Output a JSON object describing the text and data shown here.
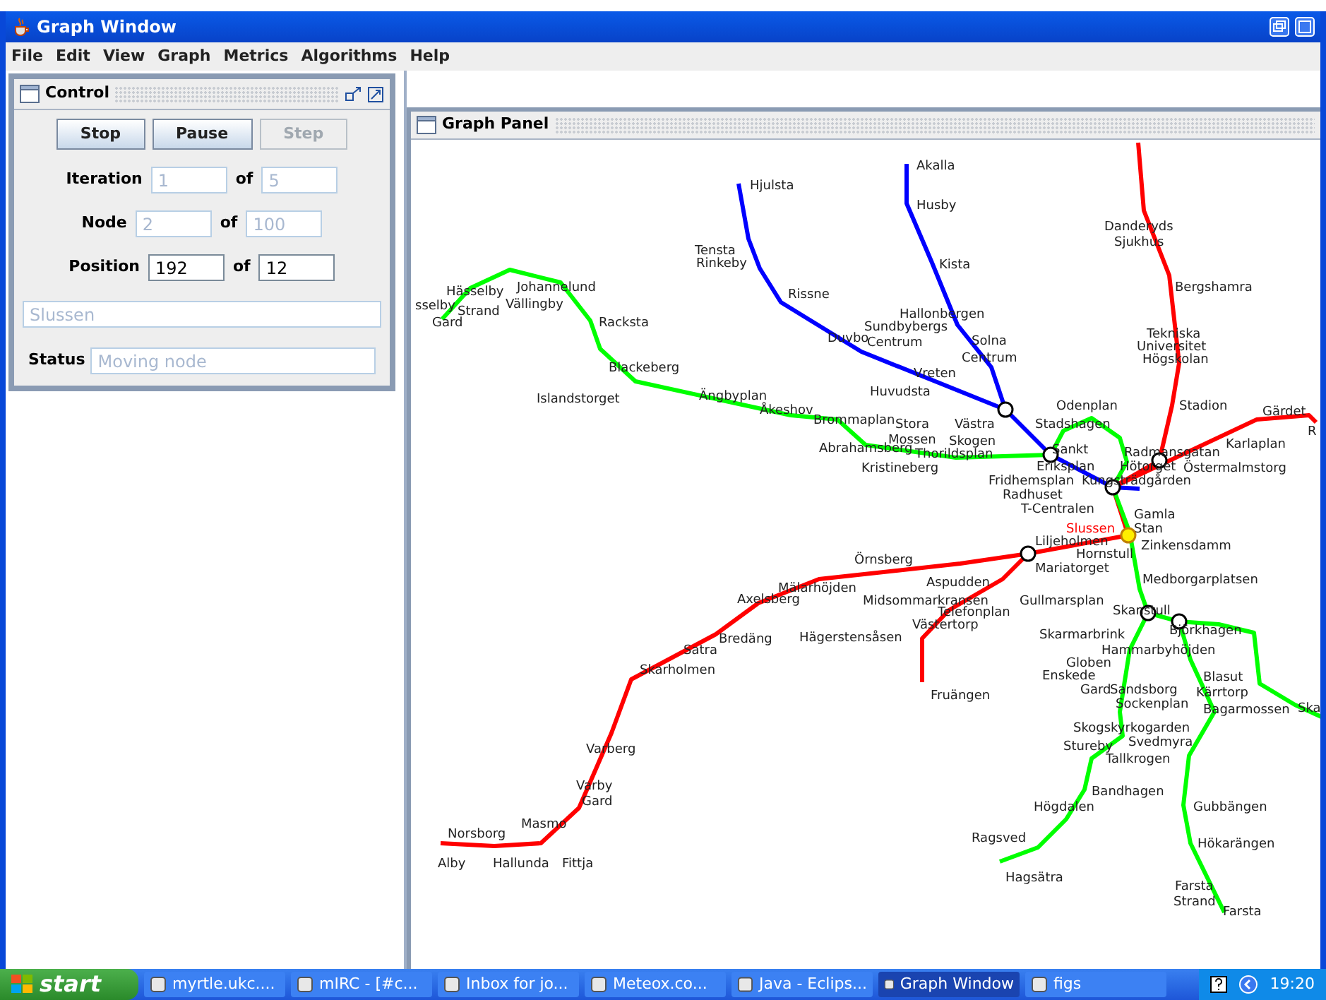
{
  "window": {
    "title": "Graph Window"
  },
  "menu": [
    "File",
    "Edit",
    "View",
    "Graph",
    "Metrics",
    "Algorithms",
    "Help"
  ],
  "control_panel": {
    "title": "Control",
    "buttons": [
      {
        "label": "Stop",
        "disabled": false
      },
      {
        "label": "Pause",
        "disabled": false
      },
      {
        "label": "Step",
        "disabled": true
      }
    ],
    "rows": [
      {
        "label": "Iteration",
        "value": "1",
        "of": "of",
        "total": "5",
        "disabled": true
      },
      {
        "label": "Node",
        "value": "2",
        "of": "of",
        "total": "100",
        "disabled": true
      },
      {
        "label": "Position",
        "value": "192",
        "of": "of",
        "total": "12",
        "disabled": false
      }
    ],
    "station_field": {
      "value": "Slussen",
      "disabled": true
    },
    "status": {
      "label": "Status",
      "value": "Moving node",
      "disabled": true
    }
  },
  "graph_panel": {
    "title": "Graph Panel",
    "lines": [
      {
        "color": "#ff0000"
      },
      {
        "color": "#0000ff"
      },
      {
        "color": "#00ff00"
      }
    ],
    "stations": [
      {
        "name": "Hjulsta",
        "selected": false
      },
      {
        "name": "Tensta",
        "selected": false
      },
      {
        "name": "Rinkeby",
        "selected": false
      },
      {
        "name": "Rissne",
        "selected": false
      },
      {
        "name": "Akalla",
        "selected": false
      },
      {
        "name": "Husby",
        "selected": false
      },
      {
        "name": "Kista",
        "selected": false
      },
      {
        "name": "Hallonbergen",
        "selected": false
      },
      {
        "name": "Sundbybergs",
        "selected": false
      },
      {
        "name": "Duvbo",
        "selected": false
      },
      {
        "name": "Centrum",
        "selected": false
      },
      {
        "name": "Solna",
        "selected": false
      },
      {
        "name": "Centrum",
        "selected": false
      },
      {
        "name": "Vreten",
        "selected": false
      },
      {
        "name": "Huvudsta",
        "selected": false
      },
      {
        "name": "Västra",
        "selected": false
      },
      {
        "name": "Skogen",
        "selected": false
      },
      {
        "name": "Stora",
        "selected": false
      },
      {
        "name": "Mossen",
        "selected": false
      },
      {
        "name": "Brommaplan",
        "selected": false
      },
      {
        "name": "Åkeshov",
        "selected": false
      },
      {
        "name": "Islandstorget",
        "selected": false
      },
      {
        "name": "Ängbyplan",
        "selected": false
      },
      {
        "name": "Racksta",
        "selected": false
      },
      {
        "name": "Blackeberg",
        "selected": false
      },
      {
        "name": "Johannelund",
        "selected": false
      },
      {
        "name": "Vällingby",
        "selected": false
      },
      {
        "name": "Hässelby",
        "selected": false
      },
      {
        "name": "sselby",
        "selected": false
      },
      {
        "name": "Strand",
        "selected": false
      },
      {
        "name": "Gard",
        "selected": false
      },
      {
        "name": "Abrahamsberg",
        "selected": false
      },
      {
        "name": "Thorildsplan",
        "selected": false
      },
      {
        "name": "Kristineberg",
        "selected": false
      },
      {
        "name": "Odenplan",
        "selected": false
      },
      {
        "name": "Stadshagen",
        "selected": false
      },
      {
        "name": "Sankt",
        "selected": false
      },
      {
        "name": "Eriksplan",
        "selected": false
      },
      {
        "name": "Fridhemsplan",
        "selected": false
      },
      {
        "name": "Kungsträdgården",
        "selected": false
      },
      {
        "name": "Radhuset",
        "selected": false
      },
      {
        "name": "T-Centralen",
        "selected": false
      },
      {
        "name": "Danderyds",
        "selected": false
      },
      {
        "name": "Sjukhus",
        "selected": false
      },
      {
        "name": "Bergshamra",
        "selected": false
      },
      {
        "name": "Tekniska",
        "selected": false
      },
      {
        "name": "Universitet",
        "selected": false
      },
      {
        "name": "Högskolan",
        "selected": false
      },
      {
        "name": "Stadion",
        "selected": false
      },
      {
        "name": "Gärdet",
        "selected": false
      },
      {
        "name": "R",
        "selected": false
      },
      {
        "name": "Karlaplan",
        "selected": false
      },
      {
        "name": "Radmansgatan",
        "selected": false
      },
      {
        "name": "Hötorget",
        "selected": false
      },
      {
        "name": "Östermalmstorg",
        "selected": false
      },
      {
        "name": "Gamla",
        "selected": false
      },
      {
        "name": "Stan",
        "selected": false
      },
      {
        "name": "Slussen",
        "selected": true
      },
      {
        "name": "Liljeholmen",
        "selected": false
      },
      {
        "name": "Hornstull",
        "selected": false
      },
      {
        "name": "Zinkensdamm",
        "selected": false
      },
      {
        "name": "Mariatorget",
        "selected": false
      },
      {
        "name": "Medborgarplatsen",
        "selected": false
      },
      {
        "name": "Gullmarsplan",
        "selected": false
      },
      {
        "name": "Skanstull",
        "selected": false
      },
      {
        "name": "Skarmarbrink",
        "selected": false
      },
      {
        "name": "Björkhagen",
        "selected": false
      },
      {
        "name": "Hammarbyhöjden",
        "selected": false
      },
      {
        "name": "Globen",
        "selected": false
      },
      {
        "name": "Enskede",
        "selected": false
      },
      {
        "name": "Blasut",
        "selected": false
      },
      {
        "name": "Gard",
        "selected": false
      },
      {
        "name": "Sandsborg",
        "selected": false
      },
      {
        "name": "Kärrtorp",
        "selected": false
      },
      {
        "name": "Sockenplan",
        "selected": false
      },
      {
        "name": "Bagarmossen",
        "selected": false
      },
      {
        "name": "Ska",
        "selected": false
      },
      {
        "name": "Skogskyrkogarden",
        "selected": false
      },
      {
        "name": "Svedmyra",
        "selected": false
      },
      {
        "name": "Stureby",
        "selected": false
      },
      {
        "name": "Tallkrogen",
        "selected": false
      },
      {
        "name": "Bandhagen",
        "selected": false
      },
      {
        "name": "Högdalen",
        "selected": false
      },
      {
        "name": "Gubbängen",
        "selected": false
      },
      {
        "name": "Ragsved",
        "selected": false
      },
      {
        "name": "Hökarängen",
        "selected": false
      },
      {
        "name": "Hagsätra",
        "selected": false
      },
      {
        "name": "Farsta",
        "selected": false
      },
      {
        "name": "Strand",
        "selected": false
      },
      {
        "name": "Farsta",
        "selected": false
      },
      {
        "name": "Örnsberg",
        "selected": false
      },
      {
        "name": "Aspudden",
        "selected": false
      },
      {
        "name": "Mälarhöjden",
        "selected": false
      },
      {
        "name": "Axelsberg",
        "selected": false
      },
      {
        "name": "Midsommarkransen",
        "selected": false
      },
      {
        "name": "Telefonplan",
        "selected": false
      },
      {
        "name": "Västertorp",
        "selected": false
      },
      {
        "name": "Bredäng",
        "selected": false
      },
      {
        "name": "Hägerstensåsen",
        "selected": false
      },
      {
        "name": "Satra",
        "selected": false
      },
      {
        "name": "Skarholmen",
        "selected": false
      },
      {
        "name": "Fruängen",
        "selected": false
      },
      {
        "name": "Varberg",
        "selected": false
      },
      {
        "name": "Varby",
        "selected": false
      },
      {
        "name": "Gard",
        "selected": false
      },
      {
        "name": "Masmo",
        "selected": false
      },
      {
        "name": "Norsborg",
        "selected": false
      },
      {
        "name": "Alby",
        "selected": false
      },
      {
        "name": "Hallunda",
        "selected": false
      },
      {
        "name": "Fittja",
        "selected": false
      }
    ]
  },
  "taskbar": {
    "start": "start",
    "items": [
      {
        "label": "myrtle.ukc....",
        "selected": false
      },
      {
        "label": "mIRC - [#c...",
        "selected": false
      },
      {
        "label": "Inbox for jo...",
        "selected": false
      },
      {
        "label": "Meteox.co...",
        "selected": false
      },
      {
        "label": "Java - Eclips...",
        "selected": false
      },
      {
        "label": "Graph Window",
        "selected": true
      },
      {
        "label": "figs",
        "selected": false
      }
    ],
    "clock": "19:20"
  }
}
